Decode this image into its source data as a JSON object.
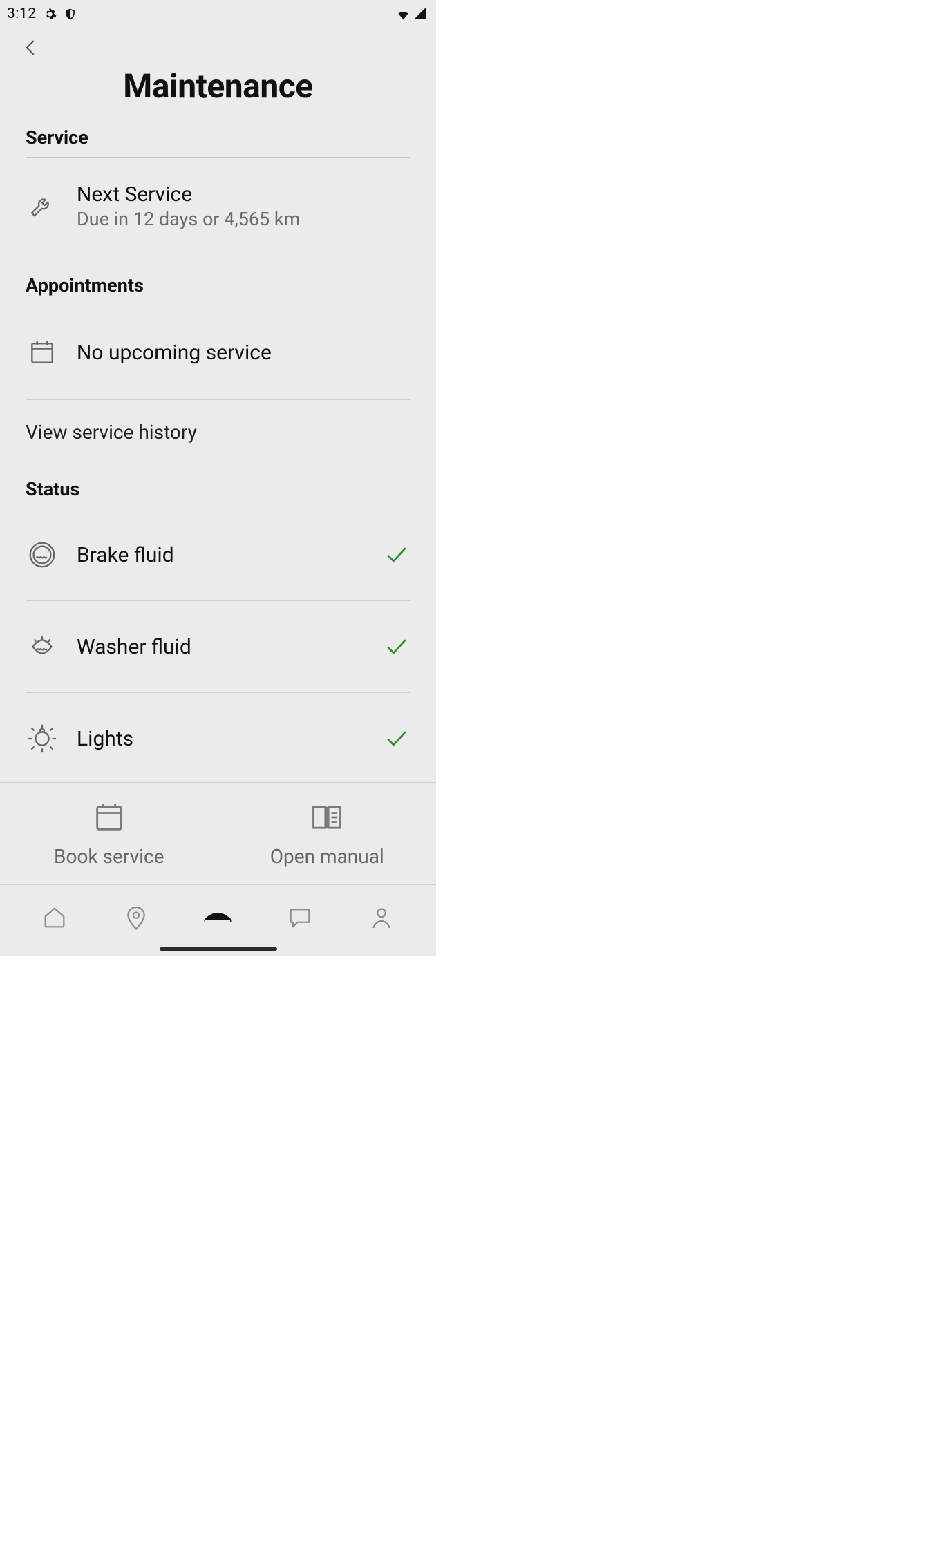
{
  "status_bar": {
    "time": "3:12"
  },
  "page_title": "Maintenance",
  "sections": {
    "service": {
      "header": "Service",
      "next_service": {
        "title": "Next Service",
        "subtitle": "Due in 12 days or 4,565 km"
      }
    },
    "appointments": {
      "header": "Appointments",
      "none_label": "No upcoming service",
      "history_link": "View service history"
    },
    "status": {
      "header": "Status",
      "items": [
        {
          "label": "Brake fluid",
          "ok": true,
          "icon": "brake-fluid-icon"
        },
        {
          "label": "Washer fluid",
          "ok": true,
          "icon": "washer-fluid-icon"
        },
        {
          "label": "Lights",
          "ok": true,
          "icon": "lights-icon"
        }
      ]
    }
  },
  "actions": {
    "book": "Book service",
    "manual": "Open manual"
  },
  "colors": {
    "ok": "#2f8b2f",
    "muted": "#6b6b6b",
    "text": "#111111"
  }
}
